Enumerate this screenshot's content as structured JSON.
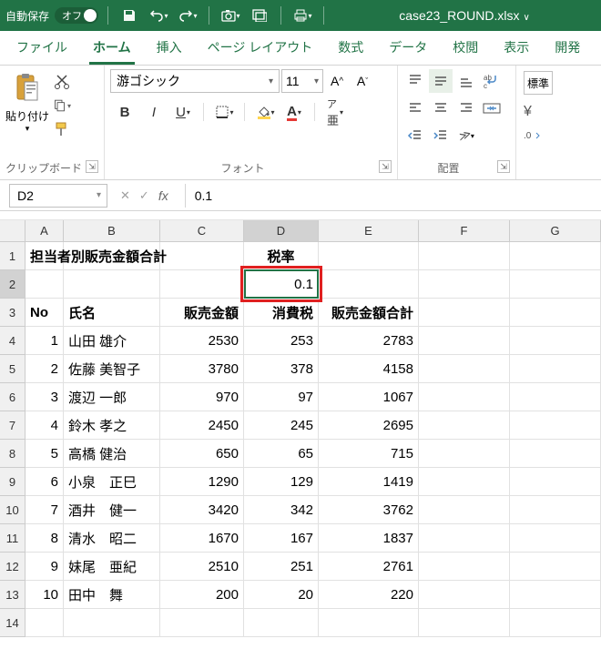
{
  "titlebar": {
    "auto_save_label": "自動保存",
    "auto_save_state": "オフ",
    "filename": "case23_ROUND.xlsx"
  },
  "tabs": [
    "ファイル",
    "ホーム",
    "挿入",
    "ページ レイアウト",
    "数式",
    "データ",
    "校閲",
    "表示",
    "開発"
  ],
  "active_tab": 1,
  "ribbon": {
    "clipboard": {
      "paste": "貼り付け",
      "label": "クリップボード"
    },
    "font": {
      "name": "游ゴシック",
      "size": "11",
      "label": "フォント"
    },
    "alignment": {
      "label": "配置"
    },
    "styles": {
      "std": "標準"
    }
  },
  "namebox": "D2",
  "formula": "0.1",
  "columns": [
    "A",
    "B",
    "C",
    "D",
    "E",
    "F",
    "G"
  ],
  "selected_col_index": 3,
  "selected_row_index": 1,
  "title_row": {
    "title": "担当者別販売金額合計",
    "tax_label": "税率"
  },
  "tax_value": "0.1",
  "headers": {
    "no": "No",
    "name": "氏名",
    "amount": "販売金額",
    "tax": "消費税",
    "total": "販売金額合計"
  },
  "rows": [
    {
      "no": "1",
      "name": "山田 雄介",
      "amount": "2530",
      "tax": "253",
      "total": "2783"
    },
    {
      "no": "2",
      "name": "佐藤 美智子",
      "amount": "3780",
      "tax": "378",
      "total": "4158"
    },
    {
      "no": "3",
      "name": "渡辺 一郎",
      "amount": "970",
      "tax": "97",
      "total": "1067"
    },
    {
      "no": "4",
      "name": "鈴木 孝之",
      "amount": "2450",
      "tax": "245",
      "total": "2695"
    },
    {
      "no": "5",
      "name": "高橋 健治",
      "amount": "650",
      "tax": "65",
      "total": "715"
    },
    {
      "no": "6",
      "name": "小泉　正巳",
      "amount": "1290",
      "tax": "129",
      "total": "1419"
    },
    {
      "no": "7",
      "name": "酒井　健一",
      "amount": "3420",
      "tax": "342",
      "total": "3762"
    },
    {
      "no": "8",
      "name": "清水　昭二",
      "amount": "1670",
      "tax": "167",
      "total": "1837"
    },
    {
      "no": "9",
      "name": "妹尾　亜紀",
      "amount": "2510",
      "tax": "251",
      "total": "2761"
    },
    {
      "no": "10",
      "name": "田中　舞",
      "amount": "200",
      "tax": "20",
      "total": "220"
    }
  ]
}
